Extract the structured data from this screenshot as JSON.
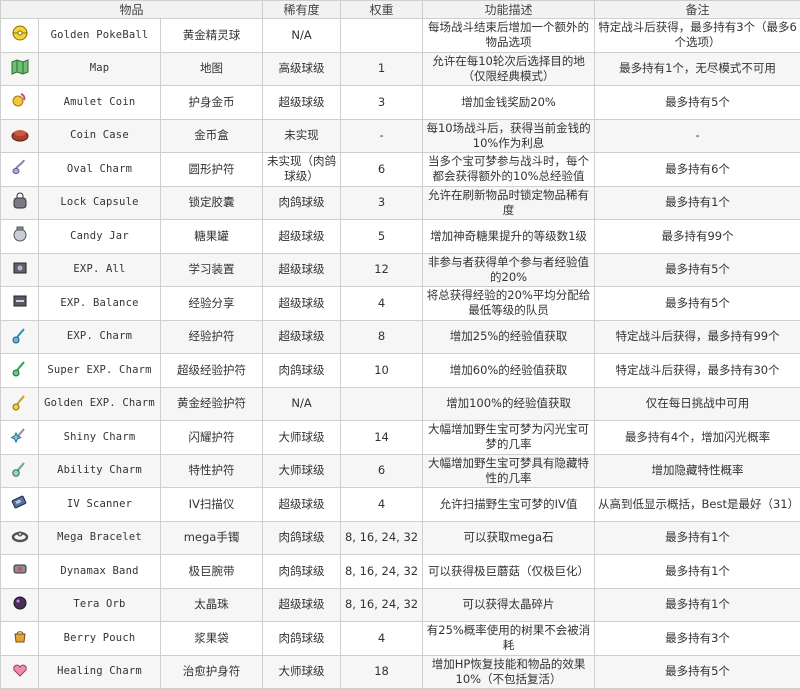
{
  "headers": [
    "物品",
    "稀有度",
    "权重",
    "功能描述",
    "备注"
  ],
  "rows": [
    {
      "icon": "golden-pokeball-icon",
      "en": "Golden PokeBall",
      "zh": "黄金精灵球",
      "rarity": "N/A",
      "weight": "",
      "desc": "每场战斗结束后增加一个额外的物品选项",
      "note": "特定战斗后获得，最多持有3个（最多6个选项）"
    },
    {
      "icon": "map-icon",
      "en": "Map",
      "zh": "地图",
      "rarity": "高级球级",
      "weight": "1",
      "desc": "允许在每10轮次后选择目的地（仅限经典模式）",
      "note": "最多持有1个，无尽模式不可用"
    },
    {
      "icon": "amulet-coin-icon",
      "en": "Amulet Coin",
      "zh": "护身金币",
      "rarity": "超级球级",
      "weight": "3",
      "desc": "增加金钱奖励20%",
      "note": "最多持有5个"
    },
    {
      "icon": "coin-case-icon",
      "en": "Coin Case",
      "zh": "金币盒",
      "rarity": "未实现",
      "weight": "-",
      "desc": "每10场战斗后，获得当前金钱的10%作为利息",
      "note": "-"
    },
    {
      "icon": "oval-charm-icon",
      "en": "Oval Charm",
      "zh": "圆形护符",
      "rarity": "未实现（肉鸽球级）",
      "weight": "6",
      "desc": "当多个宝可梦参与战斗时，每个都会获得额外的10%总经验值",
      "note": "最多持有6个"
    },
    {
      "icon": "lock-capsule-icon",
      "en": "Lock Capsule",
      "zh": "锁定胶囊",
      "rarity": "肉鸽球级",
      "weight": "3",
      "desc": "允许在刷新物品时锁定物品稀有度",
      "note": "最多持有1个"
    },
    {
      "icon": "candy-jar-icon",
      "en": "Candy Jar",
      "zh": "糖果罐",
      "rarity": "超级球级",
      "weight": "5",
      "desc": "增加神奇糖果提升的等级数1级",
      "note": "最多持有99个"
    },
    {
      "icon": "exp-all-icon",
      "en": "EXP. All",
      "zh": "学习装置",
      "rarity": "超级球级",
      "weight": "12",
      "desc": "非参与者获得单个参与者经验值的20%",
      "note": "最多持有5个"
    },
    {
      "icon": "exp-balance-icon",
      "en": "EXP. Balance",
      "zh": "经验分享",
      "rarity": "超级球级",
      "weight": "4",
      "desc": "将总获得经验的20%平均分配给最低等级的队员",
      "note": "最多持有5个"
    },
    {
      "icon": "exp-charm-icon",
      "en": "EXP. Charm",
      "zh": "经验护符",
      "rarity": "超级球级",
      "weight": "8",
      "desc": "增加25%的经验值获取",
      "note": "特定战斗后获得，最多持有99个"
    },
    {
      "icon": "super-exp-charm-icon",
      "en": "Super EXP. Charm",
      "zh": "超级经验护符",
      "rarity": "肉鸽球级",
      "weight": "10",
      "desc": "增加60%的经验值获取",
      "note": "特定战斗后获得，最多持有30个"
    },
    {
      "icon": "golden-exp-charm-icon",
      "en": "Golden EXP. Charm",
      "zh": "黄金经验护符",
      "rarity": "N/A",
      "weight": "",
      "desc": "增加100%的经验值获取",
      "note": "仅在每日挑战中可用"
    },
    {
      "icon": "shiny-charm-icon",
      "en": "Shiny Charm",
      "zh": "闪耀护符",
      "rarity": "大师球级",
      "weight": "14",
      "desc": "大幅增加野生宝可梦为闪光宝可梦的几率",
      "note": "最多持有4个，增加闪光概率"
    },
    {
      "icon": "ability-charm-icon",
      "en": "Ability Charm",
      "zh": "特性护符",
      "rarity": "大师球级",
      "weight": "6",
      "desc": "大幅增加野生宝可梦具有隐藏特性的几率",
      "note": "增加隐藏特性概率"
    },
    {
      "icon": "iv-scanner-icon",
      "en": "IV Scanner",
      "zh": "IV扫描仪",
      "rarity": "超级球级",
      "weight": "4",
      "desc": "允许扫描野生宝可梦的IV值",
      "note": "从高到低显示概括，Best是最好（31）"
    },
    {
      "icon": "mega-bracelet-icon",
      "en": "Mega Bracelet",
      "zh": "mega手镯",
      "rarity": "肉鸽球级",
      "weight": "8, 16, 24, 32",
      "desc": "可以获取mega石",
      "note": "最多持有1个"
    },
    {
      "icon": "dynamax-band-icon",
      "en": "Dynamax Band",
      "zh": "极巨腕带",
      "rarity": "肉鸽球级",
      "weight": "8, 16, 24, 32",
      "desc": "可以获得极巨蘑菇（仅极巨化）",
      "note": "最多持有1个"
    },
    {
      "icon": "tera-orb-icon",
      "en": "Tera Orb",
      "zh": "太晶珠",
      "rarity": "超级球级",
      "weight": "8, 16, 24, 32",
      "desc": "可以获得太晶碎片",
      "note": "最多持有1个"
    },
    {
      "icon": "berry-pouch-icon",
      "en": "Berry Pouch",
      "zh": "浆果袋",
      "rarity": "肉鸽球级",
      "weight": "4",
      "desc": "有25%概率使用的树果不会被消耗",
      "note": "最多持有3个"
    },
    {
      "icon": "healing-charm-icon",
      "en": "Healing Charm",
      "zh": "治愈护身符",
      "rarity": "大师球级",
      "weight": "18",
      "desc": "增加HP恢复技能和物品的效果10%（不包括复活）",
      "note": "最多持有5个"
    }
  ]
}
